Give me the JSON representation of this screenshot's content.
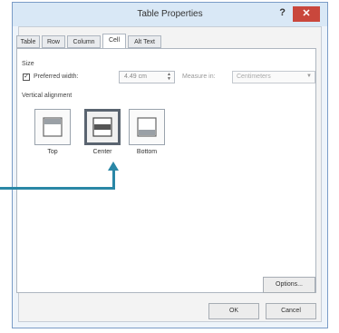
{
  "window": {
    "title": "Table Properties",
    "help": "?",
    "close": "✕"
  },
  "tabs": [
    "Table",
    "Row",
    "Column",
    "Cell",
    "Alt Text"
  ],
  "active_tab": "Cell",
  "size": {
    "section_label": "Size",
    "preferred_width_label": "Preferred width:",
    "preferred_width_checked": true,
    "width_value": "4.49 cm",
    "measure_in_label": "Measure in:",
    "measure_in_value": "Centimeters"
  },
  "vertical_alignment": {
    "label": "Vertical alignment",
    "options": [
      "Top",
      "Center",
      "Bottom"
    ],
    "selected": "Center"
  },
  "buttons": {
    "options": "Options...",
    "ok": "OK",
    "cancel": "Cancel"
  },
  "colors": {
    "accent_arrow": "#2a87a6",
    "close_button": "#c9473c",
    "titlebar": "#d9e8f6"
  }
}
